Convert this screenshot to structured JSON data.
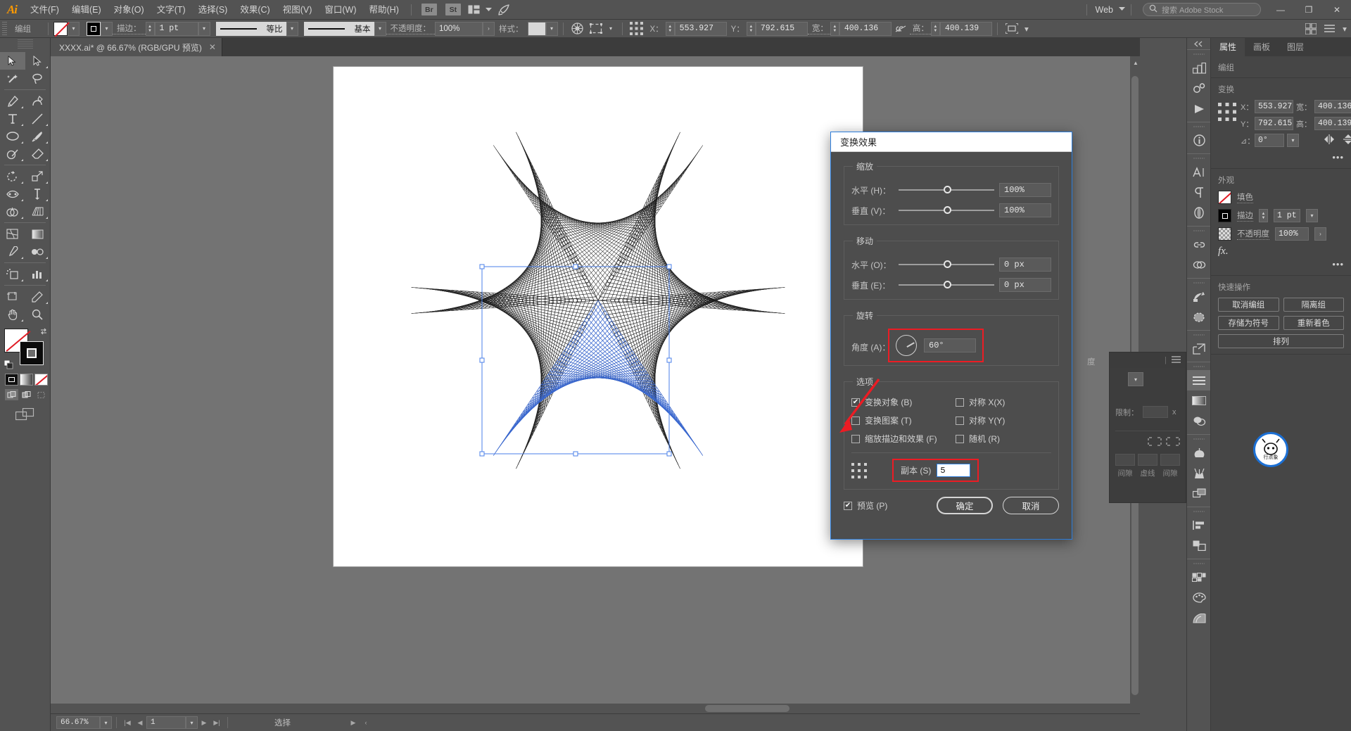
{
  "app": {
    "logo": "Ai",
    "menus": [
      "文件(F)",
      "编辑(E)",
      "对象(O)",
      "文字(T)",
      "选择(S)",
      "效果(C)",
      "视图(V)",
      "窗口(W)",
      "帮助(H)"
    ],
    "quick_apps": [
      "Br",
      "St"
    ],
    "arrange_icon": "arrange-layout-icon",
    "rocket_icon": "discover-rocket-icon",
    "workspace": "Web",
    "stock_search_placeholder": "搜索 Adobe Stock",
    "window_buttons": {
      "minimize": "—",
      "maximize": "❐",
      "close": "✕"
    }
  },
  "control_bar": {
    "selection_type": "编组",
    "fill_swatch": "none-fill-swatch",
    "stroke_swatch": "black-stroke-swatch",
    "stroke_label": "描边：",
    "stroke_weight": "1 pt",
    "stroke_profile": "等比",
    "brush_profile": "基本",
    "opacity_label": "不透明度：",
    "opacity_value": "100%",
    "style_label": "样式：",
    "transform_x_label": "X：",
    "transform_x": "553.927",
    "transform_y_label": "Y：",
    "transform_y": "792.615",
    "transform_w_label": "宽：",
    "transform_w": "400.136",
    "transform_h_label": "高：",
    "transform_h": "400.139",
    "link_icon": "unlink-proportions-icon",
    "align_icon": "align-icon"
  },
  "document": {
    "tab_title": "XXXX.ai* @ 66.67% (RGB/GPU 预览)",
    "close_glyph": "✕"
  },
  "toolbar": {
    "tools": [
      "selection-tool",
      "direct-selection-tool",
      "magic-wand-tool",
      "lasso-tool",
      "pen-tool",
      "curvature-tool",
      "type-tool",
      "line-segment-tool",
      "ellipse-tool",
      "paintbrush-tool",
      "shaper-tool",
      "eraser-tool",
      "rotate-tool",
      "scale-tool",
      "width-tool",
      "free-transform-tool",
      "shape-builder-tool",
      "perspective-grid-tool",
      "mesh-tool",
      "gradient-tool",
      "eyedropper-tool",
      "blend-tool",
      "symbol-sprayer-tool",
      "column-graph-tool",
      "artboard-tool",
      "slice-tool",
      "hand-tool",
      "zoom-tool"
    ],
    "fill_swatch": "none-fill-swatch",
    "stroke_swatch": "black-stroke-swatch",
    "swap_icon": "swap-fill-stroke-icon",
    "default_icon": "default-fill-stroke-icon",
    "color_modes": [
      "color-swatch-mode",
      "gradient-mode",
      "none-mode"
    ],
    "draw_modes": [
      "draw-normal",
      "draw-behind",
      "draw-inside"
    ],
    "screen_mode": "change-screen-mode-icon"
  },
  "status_bar": {
    "zoom": "66.67%",
    "first_page_icon": "first-page-icon",
    "prev_page_icon": "prev-page-icon",
    "page": "1",
    "next_page_icon": "next-page-icon",
    "last_page_icon": "last-page-icon",
    "status_text": "选择",
    "more_icon": "status-more-icon"
  },
  "panel_rail": {
    "collapse_icon": "collapse-panels-icon",
    "icons": [
      "libraries-icon",
      "properties-gears-icon",
      "actions-play-icon",
      "document-info-icon",
      "character-icon",
      "paragraph-icon",
      "appearance-icon",
      "links-icon",
      "pathfinder-icon",
      "image-trace-icon",
      "graphic-styles-icon",
      "export-icon",
      "stroke-icon",
      "gradient-icon",
      "transparency-icon",
      "brushes-icon",
      "symbols-icon",
      "layers-stack-icon",
      "align-icon",
      "transform-icon",
      "artboards-icon",
      "color-palette-icon",
      "color-guide-icon"
    ]
  },
  "properties_panel": {
    "tabs": [
      "属性",
      "画板",
      "图层"
    ],
    "active_tab": "属性",
    "selection_label": "编组",
    "transform": {
      "heading": "变换",
      "ref_point_icon": "reference-point-grid-icon",
      "x_label": "X：",
      "x_value": "553.927",
      "y_label": "Y：",
      "y_value": "792.615",
      "w_label": "宽：",
      "w_value": "400.136",
      "h_label": "高：",
      "h_value": "400.139",
      "angle_label": "⊿：",
      "angle_value": "0°",
      "link_icon": "unlink-proportions-icon",
      "flip_h_icon": "flip-horizontal-icon",
      "flip_v_icon": "flip-vertical-icon",
      "more_icon": "transform-more-icon"
    },
    "appearance": {
      "heading": "外观",
      "fill_label": "填色",
      "stroke_label": "描边",
      "stroke_weight": "1 pt",
      "opacity_label": "不透明度",
      "opacity_value": "100%",
      "fx_label": "fx.",
      "more_icon": "appearance-more-icon"
    },
    "quick_actions": {
      "heading": "快速操作",
      "buttons": [
        "取消编组",
        "隔离组",
        "存储为符号",
        "重新着色",
        "排列"
      ]
    }
  },
  "background_panel": {
    "title_fragment": "度",
    "expand_icon": "expand-panel-icon",
    "menu_icon": "panel-menu-icon",
    "limit_label": "限制：",
    "limit_unit": "x",
    "corner_icons": [
      "corner-join-round-icon",
      "corner-join-bevel-icon"
    ],
    "columns": [
      "间隙",
      "虚线",
      "间隙"
    ]
  },
  "dialog": {
    "title": "变换效果",
    "scale": {
      "heading": "缩放",
      "horizontal_label": "水平 (H)：",
      "horizontal_value": "100%",
      "vertical_label": "垂直 (V)：",
      "vertical_value": "100%"
    },
    "move": {
      "heading": "移动",
      "horizontal_label": "水平 (O)：",
      "horizontal_value": "0 px",
      "vertical_label": "垂直 (E)：",
      "vertical_value": "0 px"
    },
    "rotate": {
      "heading": "旋转",
      "angle_label": "角度 (A)：",
      "angle_value": "60°",
      "dial_icon": "angle-dial-icon",
      "highlight_color": "#ec1c24"
    },
    "options": {
      "heading": "选项",
      "items": [
        {
          "label": "变换对象 (B)",
          "checked": true
        },
        {
          "label": "对称 X(X)",
          "checked": false
        },
        {
          "label": "变换图案 (T)",
          "checked": false
        },
        {
          "label": "对称 Y(Y)",
          "checked": false
        },
        {
          "label": "缩放描边和效果 (F)",
          "checked": false
        },
        {
          "label": "随机 (R)",
          "checked": false
        }
      ],
      "ref_point_icon": "reference-point-grid-icon",
      "copies_label": "副本 (S)",
      "copies_value": "5",
      "highlight_color": "#ec1c24"
    },
    "footer": {
      "preview_label": "预览 (P)",
      "preview_checked": true,
      "ok_label": "确定",
      "cancel_label": "取消"
    }
  },
  "artwork": {
    "description": "geometric-string-art-rosette",
    "black_color": "#1a1a1a",
    "selected_color": "#3d6fe0",
    "selection_bbox_color": "#4a7fe8"
  }
}
